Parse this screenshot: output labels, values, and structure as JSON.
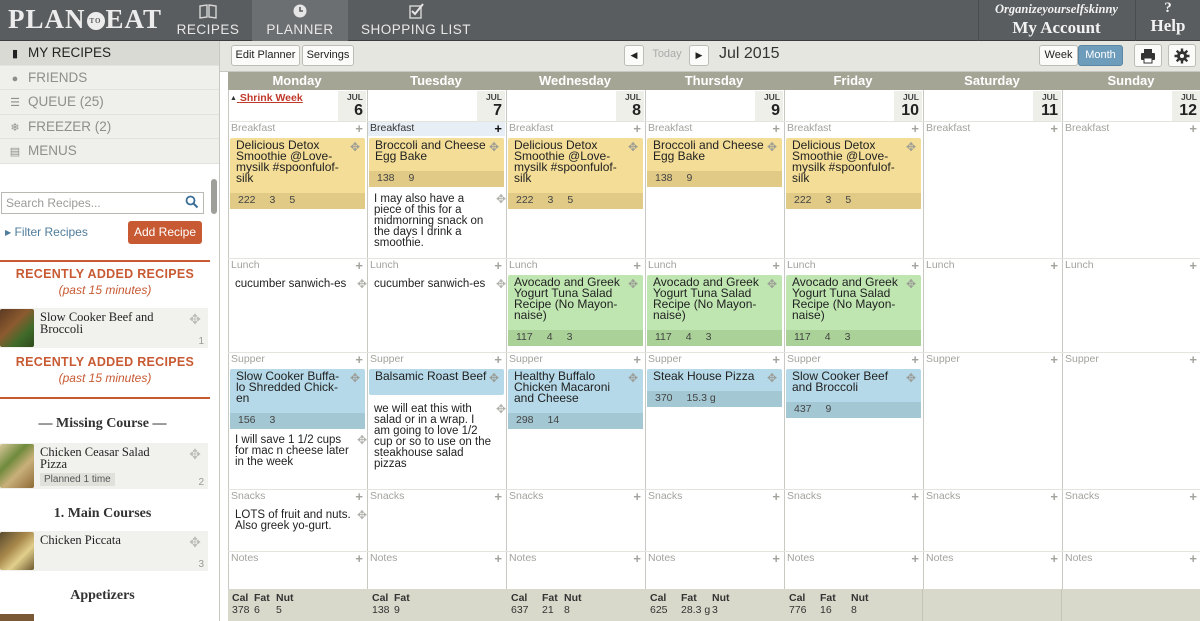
{
  "topbar": {
    "logo": {
      "left": "PLAN",
      "middle": "TO",
      "right": "EAT"
    },
    "tabs": [
      {
        "label": "RECIPES",
        "icon": "book-icon"
      },
      {
        "label": "PLANNER",
        "icon": "clock-icon"
      },
      {
        "label": "SHOPPING LIST",
        "icon": "checklist-icon"
      }
    ],
    "account": {
      "username": "Organizeyourselfskinny",
      "label": "My Account"
    },
    "help": {
      "symbol": "?",
      "label": "Help"
    }
  },
  "sidebar": {
    "nav": [
      {
        "label": "MY RECIPES",
        "icon": "bookmark-icon",
        "active": true
      },
      {
        "label": "FRIENDS",
        "icon": "person-icon",
        "active": false
      },
      {
        "label": "QUEUE (25)",
        "icon": "list-icon",
        "active": false
      },
      {
        "label": "FREEZER (2)",
        "icon": "snowflake-icon",
        "active": false
      },
      {
        "label": "MENUS",
        "icon": "book-icon",
        "active": false
      }
    ],
    "search_placeholder": "Search Recipes...",
    "filter_label": "Filter Recipes",
    "add_recipe_label": "Add Recipe",
    "recent1": {
      "title": "RECENTLY ADDED RECIPES",
      "subtitle": "(past 15 minutes)"
    },
    "recent2": {
      "title": "RECENTLY ADDED RECIPES",
      "subtitle": "(past 15 minutes)"
    },
    "missing_course": "— Missing Course —",
    "main_courses": "1. Main Courses",
    "appetizers": "Appetizers",
    "recipes": [
      {
        "name": "Slow Cooker Beef and Broccoli",
        "count": "1"
      },
      {
        "name": "Chicken Ceasar Salad Pizza",
        "count": "2",
        "planned": "Planned 1 time"
      },
      {
        "name": "Chicken Piccata",
        "count": "3"
      }
    ]
  },
  "toolbar": {
    "edit_planner": "Edit Planner",
    "servings": "Servings",
    "prev": "◀",
    "today": "Today",
    "next": "▶",
    "month_title": "Jul 2015",
    "week": "Week",
    "month": "Month"
  },
  "planner": {
    "shrink_week": "Shrink Week",
    "meal_labels": {
      "breakfast": "Breakfast",
      "lunch": "Lunch",
      "supper": "Supper",
      "snacks": "Snacks",
      "notes": "Notes"
    },
    "days": [
      {
        "name": "Monday",
        "month": "JUL",
        "date": "6"
      },
      {
        "name": "Tuesday",
        "month": "JUL",
        "date": "7"
      },
      {
        "name": "Wednesday",
        "month": "JUL",
        "date": "8"
      },
      {
        "name": "Thursday",
        "month": "JUL",
        "date": "9"
      },
      {
        "name": "Friday",
        "month": "JUL",
        "date": "10"
      },
      {
        "name": "Saturday",
        "month": "JUL",
        "date": "11"
      },
      {
        "name": "Sunday",
        "month": "JUL",
        "date": "12"
      }
    ],
    "breakfast": [
      {
        "name": "Delicious Detox Smoothie @Love-mysilk #spoonfulof-silk",
        "stats": [
          "222",
          "3",
          "5"
        ]
      },
      {
        "name": "Broccoli and Cheese Egg Bake",
        "stats": [
          "138",
          "9"
        ]
      },
      {
        "name": "Delicious Detox Smoothie @Love-mysilk #spoonfulof-silk",
        "stats": [
          "222",
          "3",
          "5"
        ]
      },
      {
        "name": "Broccoli and Cheese Egg Bake",
        "stats": [
          "138",
          "9"
        ]
      },
      {
        "name": "Delicious Detox Smoothie @Love-mysilk #spoonfulof-silk",
        "stats": [
          "222",
          "3",
          "5"
        ]
      }
    ],
    "lunch": [
      {
        "name": "Avocado and Greek Yogurt Tuna Salad Recipe (No Mayon-naise)",
        "stats": [
          "117",
          "4",
          "3"
        ]
      },
      {
        "name": "Avocado and Greek Yogurt Tuna Salad Recipe (No Mayon-naise)",
        "stats": [
          "117",
          "4",
          "3"
        ]
      },
      {
        "name": "Avocado and Greek Yogurt Tuna Salad Recipe (No Mayon-naise)",
        "stats": [
          "117",
          "4",
          "3"
        ]
      }
    ],
    "supper": [
      {
        "name": "Slow Cooker Buffa-lo Shredded Chick-en",
        "stats": [
          "156",
          "3"
        ]
      },
      {
        "name": "Balsamic Roast Beef",
        "stats": []
      },
      {
        "name": "Healthy Buffalo Chicken Macaroni and Cheese",
        "stats": [
          "298",
          "14"
        ]
      },
      {
        "name": "Steak House Pizza",
        "stats": [
          "370",
          "15.3 g"
        ]
      },
      {
        "name": "Slow Cooker Beef and Broccoli",
        "stats": [
          "437",
          "9"
        ]
      }
    ],
    "notes": {
      "tue_breakfast": "I may also have a piece of this for a midmorning snack on the days I drink a smoothie.",
      "mon_lunch": "cucumber sanwich-es",
      "tue_lunch": "cucumber sanwich-es",
      "mon_supper": "I will save 1 1/2 cups for mac n cheese later in the week",
      "tue_supper": "we will eat this with salad or in a wrap. I am going to love 1/2 cup or so to use on the steakhouse salad pizzas",
      "mon_snacks": "LOTS of fruit and nuts. Also greek yo-gurt."
    },
    "totals_headers": [
      "Cal",
      "Fat",
      "Nut"
    ],
    "totals": [
      [
        "378",
        "6",
        "5"
      ],
      [
        "138",
        "9",
        ""
      ],
      [
        "637",
        "21",
        "8"
      ],
      [
        "625",
        "28.3 g",
        "3"
      ],
      [
        "776",
        "16",
        "8"
      ]
    ]
  },
  "colors": {
    "topbar": "#5a5d5f",
    "accent": "#c85a33",
    "breakfast_card": "#f3dd97",
    "lunch_card": "#bfe6b1",
    "supper_card": "#b5d9e8",
    "day_header": "#a5a596"
  }
}
